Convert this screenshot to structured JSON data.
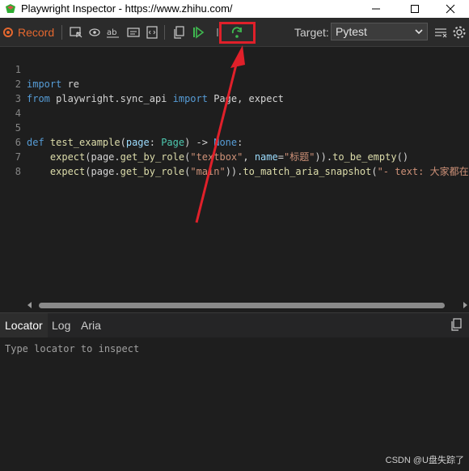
{
  "window": {
    "title": "Playwright Inspector - https://www.zhihu.com/",
    "minimize_icon": "minimize-icon",
    "maximize_icon": "maximize-icon",
    "close_icon": "close-icon"
  },
  "toolbar": {
    "record_label": "Record",
    "target_label": "Target:",
    "target_value": "Pytest",
    "icons": [
      "pick-locator-icon",
      "assert-visibility-icon",
      "assert-text-icon",
      "assert-value-icon",
      "assert-snapshot-icon",
      "copy-icon",
      "resume-icon",
      "pause-icon",
      "step-over-icon",
      "clear-icon",
      "settings-icon"
    ]
  },
  "editor": {
    "line_numbers": [
      "1",
      "2",
      "3",
      "4",
      "5",
      "6",
      "7",
      "8"
    ],
    "lines": [
      {
        "kw": "import",
        "rest": " re"
      },
      {
        "kw": "from",
        "rest": " playwright.sync_api ",
        "kw2": "import",
        "rest2": " Page, expect"
      },
      {
        "text": ""
      },
      {
        "text": ""
      },
      {
        "kw": "def",
        "fn": " test_example",
        "rest": "(",
        "param": "page",
        "rest2": ": ",
        "type": "Page",
        "rest3": ") -> ",
        "kw2": "None",
        "rest4": ":"
      },
      {
        "indent": "    ",
        "fn": "expect",
        "rest": "(page.",
        "fn2": "get_by_role",
        "rest2": "(",
        "str": "\"textbox\"",
        "rest3": ", ",
        "param": "name",
        "rest4": "=",
        "str2": "\"标题\"",
        "rest5": ")).",
        "fn3": "to_be_empty",
        "rest6": "()"
      },
      {
        "indent": "    ",
        "fn": "expect",
        "rest": "(page.",
        "fn2": "get_by_role",
        "rest2": "(",
        "str": "\"main\"",
        "rest3": ")).",
        "fn3": "to_match_aria_snapshot",
        "rest4": "(",
        "str2": "\"- text: 大家都在搜"
      },
      {
        "text": ""
      }
    ]
  },
  "panel": {
    "tabs": [
      "Locator",
      "Log",
      "Aria"
    ],
    "active_tab": "Locator",
    "locator_placeholder": "Type locator to inspect"
  },
  "watermark": "CSDN @U盘失踪了",
  "colors": {
    "record": "#e5682f",
    "highlight": "#e0202a",
    "resume": "#3fb950",
    "step_over": "#3fb950"
  }
}
